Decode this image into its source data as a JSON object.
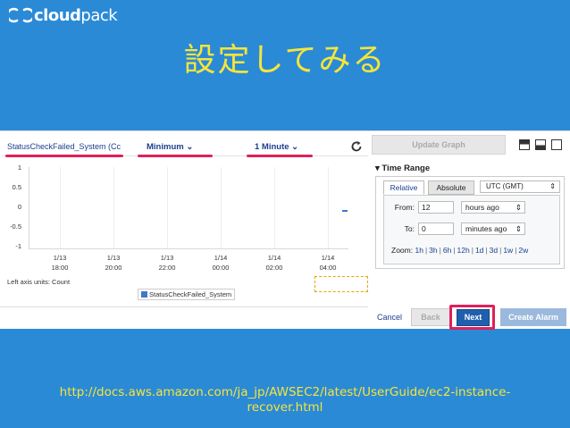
{
  "logo": {
    "bold": "cloud",
    "light": "pack"
  },
  "slide": {
    "title": "設定してみる",
    "url": "http://docs.aws.amazon.com/ja_jp/AWSEC2/latest/UserGuide/ec2-instance-recover.html"
  },
  "graph": {
    "metric_label": "StatusCheckFailed_System (Cc",
    "statistic": "Minimum",
    "period": "1 Minute",
    "y_ticks": [
      "1",
      "0.5",
      "0",
      "-0.5",
      "-1"
    ],
    "x_ticks": [
      {
        "date": "1/13",
        "time": "18:00"
      },
      {
        "date": "1/13",
        "time": "20:00"
      },
      {
        "date": "1/13",
        "time": "22:00"
      },
      {
        "date": "1/14",
        "time": "00:00"
      },
      {
        "date": "1/14",
        "time": "02:00"
      },
      {
        "date": "1/14",
        "time": "04:00"
      }
    ],
    "axis_units": "Left axis units: Count",
    "legend": "StatusCheckFailed_System"
  },
  "right_panel": {
    "update_graph": "Update Graph",
    "time_range_title": "Time Range",
    "tabs": [
      "Relative",
      "Absolute"
    ],
    "timezone": "UTC (GMT)",
    "from_label": "From:",
    "from_value": "12",
    "from_unit": "hours ago",
    "to_label": "To:",
    "to_value": "0",
    "to_unit": "minutes ago",
    "zoom_label": "Zoom:",
    "zoom_options": [
      "1h",
      "3h",
      "6h",
      "12h",
      "1d",
      "3d",
      "1w",
      "2w"
    ]
  },
  "footer_buttons": {
    "cancel": "Cancel",
    "back": "Back",
    "next": "Next",
    "create_alarm": "Create Alarm"
  },
  "colors": {
    "background": "#2b8ad6",
    "title": "#f5e53a",
    "highlight": "#e0205a"
  }
}
